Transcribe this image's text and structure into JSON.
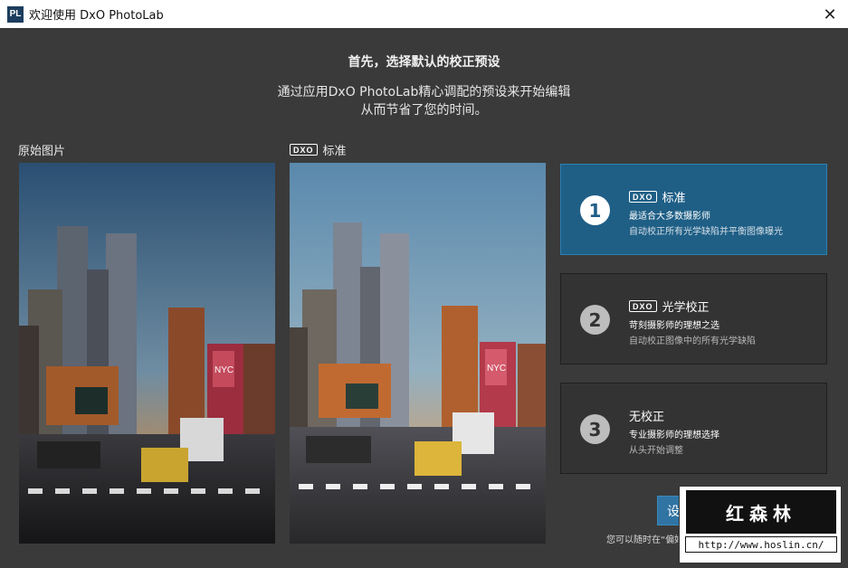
{
  "window": {
    "logo": "PL",
    "title": "欢迎使用 DxO PhotoLab",
    "close_glyph": "✕"
  },
  "intro": {
    "heading": "首先，选择默认的校正预设",
    "line1": "通过应用DxO PhotoLab精心调配的预设来开始编辑",
    "line2": "从而节省了您的时间。"
  },
  "preview": {
    "original_label": "原始图片",
    "dxo_badge": "DXO",
    "standard_label": "标准",
    "billboard_text": "NYC"
  },
  "options": [
    {
      "number": "1",
      "badge": "DXO",
      "title": "标准",
      "line1": "最适合大多数摄影师",
      "line2": "自动校正所有光学缺陷并平衡图像曝光",
      "selected": true
    },
    {
      "number": "2",
      "badge": "DXO",
      "title": "光学校正",
      "line1": "苛刻摄影师的理想之选",
      "line2": "自动校正图像中的所有光学缺陷",
      "selected": false
    },
    {
      "number": "3",
      "badge": "",
      "title": "无校正",
      "line1": "专业摄影师的理想选择",
      "line2": "从头开始调整",
      "selected": false
    }
  ],
  "footer": {
    "set_default_label": "设为默认",
    "note": "您可以随时在“偏好设"
  },
  "watermark": {
    "name": "红森林",
    "url": "http://www.hoslin.cn/"
  },
  "colors": {
    "background": "#3a3a3a",
    "selected_option": "#1f5f86",
    "button": "#2f74a3"
  }
}
